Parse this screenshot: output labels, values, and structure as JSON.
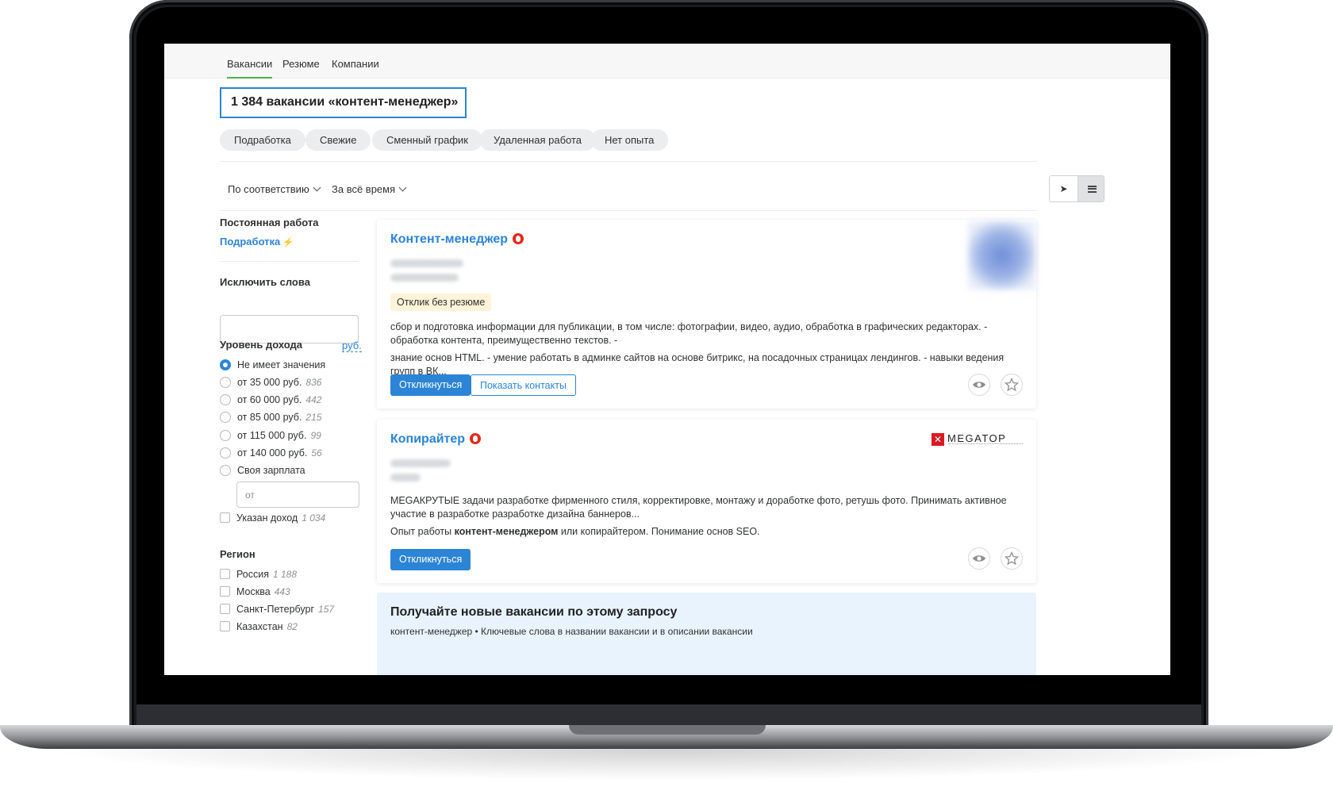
{
  "nav": {
    "tabs": [
      "Вакансии",
      "Резюме",
      "Компании"
    ]
  },
  "headline": "1 384 вакансии «контент-менеджер»",
  "chips": [
    "Подработка",
    "Свежие",
    "Сменный график",
    "Удаленная работа",
    "Нет опыта"
  ],
  "sort": {
    "relevance": "По соответствию",
    "period": "За всё время"
  },
  "sidebar": {
    "employment_title": "Постоянная работа",
    "employment_link": "Подработка",
    "exclude_title": "Исключить слова",
    "exclude_value": "",
    "income_title": "Уровень дохода",
    "currency": "руб.",
    "income_options": [
      {
        "label": "Не имеет значения",
        "count": "",
        "selected": true
      },
      {
        "label": "от 35 000 руб.",
        "count": "836",
        "selected": false
      },
      {
        "label": "от 60 000 руб.",
        "count": "442",
        "selected": false
      },
      {
        "label": "от 85 000 руб.",
        "count": "215",
        "selected": false
      },
      {
        "label": "от 115 000 руб.",
        "count": "99",
        "selected": false
      },
      {
        "label": "от 140 000 руб.",
        "count": "56",
        "selected": false
      },
      {
        "label": "Своя зарплата",
        "count": "",
        "selected": false
      }
    ],
    "salary_placeholder": "от",
    "income_specified": {
      "label": "Указан доход",
      "count": "1 034"
    },
    "region_title": "Регион",
    "regions": [
      {
        "label": "Россия",
        "count": "1 188"
      },
      {
        "label": "Москва",
        "count": "443"
      },
      {
        "label": "Санкт-Петербург",
        "count": "157"
      },
      {
        "label": "Казахстан",
        "count": "82"
      }
    ]
  },
  "vacancies": [
    {
      "title": "Контент-менеджер",
      "badge": "Отклик без резюме",
      "desc1": "сбор и подготовка информации для публикации, в том числе: фотографии, видео, аудио, обработка в графических редакторах. - обработка контента, преимущественно текстов. -",
      "desc2": "знание основ HTML. - умение работать в админке сайтов на основе битрикс, на посадочных страницах лендингов. - навыки ведения групп в ВК...",
      "apply": "Откликнуться",
      "contacts": "Показать контакты"
    },
    {
      "title": "Копирайтер",
      "logo_text": "MEGATOP",
      "desc1": "MEGAКРУТЫЕ задачи разработке фирменного стиля, корректировке, монтажу и доработке фото, ретушь фото. Принимать активное участие в разработке разработке дизайна баннеров...",
      "desc2_pre": "Опыт работы ",
      "desc2_bold": "контент-менеджером",
      "desc2_post": " или копирайтером. Понимание основ SEO.",
      "apply": "Откликнуться"
    }
  ],
  "subscribe": {
    "title": "Получайте новые вакансии по этому запросу",
    "subtitle": "контент-менеджер • Ключевые слова в названии вакансии и в описании вакансии"
  },
  "colors": {
    "accent": "#2b84d6",
    "active_tab": "#4bb24e",
    "hot": "#e32a1c",
    "badge_bg": "#fff3d9",
    "brand": "#d81b22"
  }
}
